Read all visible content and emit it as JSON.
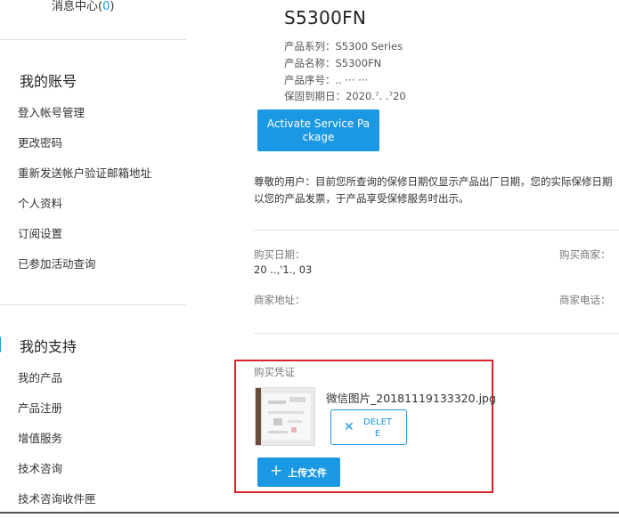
{
  "sidebar": {
    "message_center": {
      "label": "消息中心(",
      "count": "0",
      "close": ")"
    },
    "account": {
      "title": "我的账号",
      "items": [
        "登入帐号管理",
        "更改密码",
        "重新发送帐户验证邮箱地址",
        "个人资料",
        "订阅设置",
        "已参加活动查询"
      ]
    },
    "support": {
      "title": "我的支持",
      "items": [
        "我的产品",
        "产品注册",
        "增值服务",
        "技术咨询",
        "技术咨询收件匣"
      ]
    }
  },
  "product": {
    "title": "S5300FN",
    "series": "产品系列：S5300 Series",
    "name": "产品名称：S5300FN",
    "serial": "产品序号：.. ··· ···",
    "warranty": "保固到期日：2020.⁷. .⁷20"
  },
  "activate_button": {
    "line1": "Activate Service Pa",
    "line2": "ckage"
  },
  "notice": "尊敬的用户：目前您所查询的保修日期仅显示产品出厂日期，您的实际保修日期以您的产品发票，于产品享受保修服务时出示。",
  "purchase": {
    "date_label": "购买日期：",
    "date_value": "20 ..,'1., 03",
    "merchant_label": "购买商家：",
    "address_label": "商家地址：",
    "phone_label": "商家电话："
  },
  "voucher": {
    "title": "购买凭证",
    "file_name": "微信图片_20181119133320.jpg",
    "delete_line1": "DELET",
    "delete_line2": "E",
    "upload_label": "上传文件"
  },
  "colors": {
    "accent": "#1a98e3",
    "highlight": "#d6242a"
  },
  "icons": {
    "delete": "close-icon",
    "upload": "plus-icon"
  }
}
